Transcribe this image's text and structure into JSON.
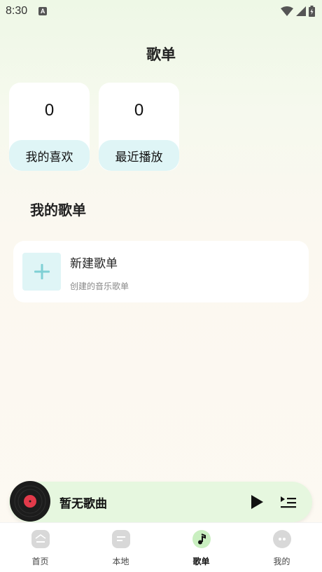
{
  "status_bar": {
    "time": "8:30",
    "notification_badge": "A"
  },
  "header": {
    "title": "歌单"
  },
  "stats": [
    {
      "count": "0",
      "label": "我的喜欢"
    },
    {
      "count": "0",
      "label": "最近播放"
    }
  ],
  "my_playlists": {
    "section_title": "我的歌单",
    "new_playlist": {
      "name": "新建歌单",
      "desc": "创建的音乐歌单"
    }
  },
  "mini_player": {
    "song_title": "暂无歌曲"
  },
  "tabs": [
    {
      "label": "首页",
      "icon": "home-icon"
    },
    {
      "label": "本地",
      "icon": "local-file-icon"
    },
    {
      "label": "歌单",
      "icon": "music-note-icon",
      "active": true
    },
    {
      "label": "我的",
      "icon": "face-icon"
    }
  ],
  "colors": {
    "accent_light": "#dff5f6",
    "player_bg": "#e6f7df",
    "active_tab": "#c9efc0"
  }
}
